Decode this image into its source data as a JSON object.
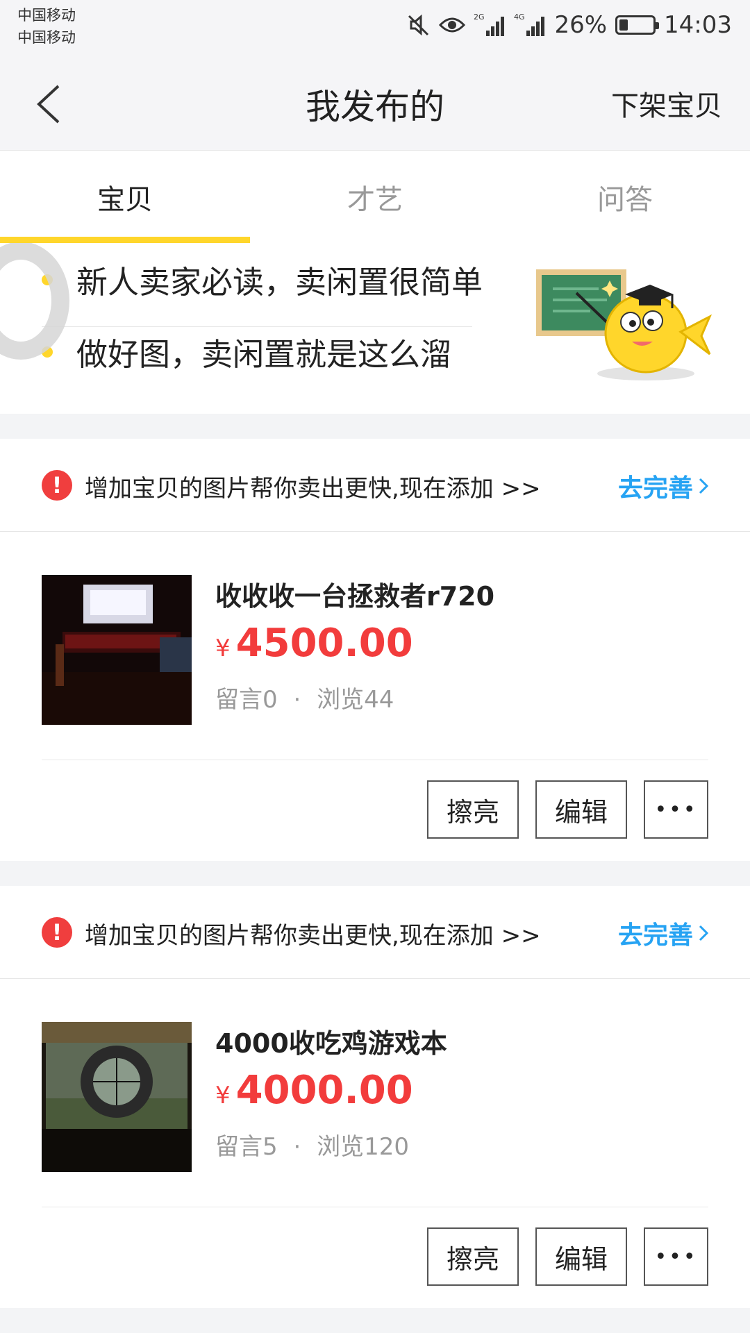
{
  "status_bar": {
    "carrier1": "中国移动",
    "carrier2": "中国移动",
    "network1": "2G",
    "network2": "4G",
    "battery": "26%",
    "battery_level": 0.26,
    "time": "14:03",
    "icons": [
      "mute-icon",
      "eye-icon",
      "signal-icon",
      "battery-icon"
    ]
  },
  "header": {
    "title": "我发布的",
    "right_action": "下架宝贝"
  },
  "tabs": [
    {
      "label": "宝贝",
      "active": true
    },
    {
      "label": "才艺",
      "active": false
    },
    {
      "label": "问答",
      "active": false
    }
  ],
  "guide": {
    "items": [
      "新人卖家必读，卖闲置很简单",
      "做好图，卖闲置就是这么溜"
    ]
  },
  "items": [
    {
      "notice": "增加宝贝的图片帮你卖出更快,现在添加 >>",
      "notice_action": "去完善",
      "title": "收收收一台拯救者r720",
      "currency": "¥",
      "price": "4500.00",
      "comments": "留言0",
      "dot": "·",
      "views": "浏览44",
      "buttons": {
        "polish": "擦亮",
        "edit": "编辑",
        "more": "•••"
      }
    },
    {
      "notice": "增加宝贝的图片帮你卖出更快,现在添加 >>",
      "notice_action": "去完善",
      "title": "4000收吃鸡游戏本",
      "currency": "¥",
      "price": "4000.00",
      "comments": "留言5",
      "dot": "·",
      "views": "浏览120",
      "buttons": {
        "polish": "擦亮",
        "edit": "编辑",
        "more": "•••"
      }
    }
  ],
  "colors": {
    "accent_yellow": "#ffd62b",
    "price_red": "#f23c3c",
    "link_blue": "#26a3f3",
    "warning_red": "#f03e3e"
  }
}
